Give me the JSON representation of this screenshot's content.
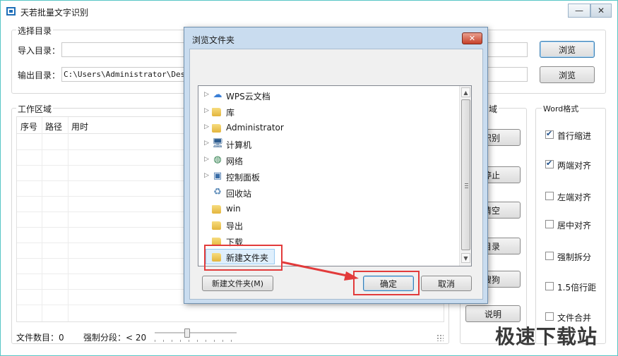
{
  "app": {
    "title": "天若批量文字识别",
    "minimize_glyph": "—",
    "close_glyph": "✕"
  },
  "dir_group": {
    "legend": "选择目录",
    "import_label": "导入目录：",
    "import_value": "",
    "output_label": "输出目录：",
    "output_value": "C:\\Users\\Administrator\\Desktop",
    "browse_label": "浏览"
  },
  "work_area": {
    "legend": "工作区域",
    "columns": [
      "序号",
      "路径",
      "用时"
    ]
  },
  "ops": {
    "legend_partial": "域",
    "buttons": [
      "识别",
      "停止",
      "清空",
      "目录",
      "搜狗",
      "说明"
    ],
    "partials": [
      "识别",
      "停止",
      "清空",
      "目录",
      "搜狗"
    ]
  },
  "word_format": {
    "legend": "Word格式",
    "options": [
      {
        "label": "首行缩进",
        "checked": true
      },
      {
        "label": "两端对齐",
        "checked": true
      },
      {
        "label": "左端对齐",
        "checked": false
      },
      {
        "label": "居中对齐",
        "checked": false
      },
      {
        "label": "强制拆分",
        "checked": false
      },
      {
        "label": "1.5倍行距",
        "checked": false
      },
      {
        "label": "文件合并",
        "checked": false
      }
    ]
  },
  "status": {
    "file_count": "文件数目：0",
    "split_label": "强制分段：< 20",
    "split_value": 20
  },
  "dialog": {
    "title": "浏览文件夹",
    "close_glyph": "✕",
    "tree": [
      {
        "label": "WPS云文档",
        "icon": "cloud-icon",
        "expandable": true
      },
      {
        "label": "库",
        "icon": "library-icon",
        "expandable": true
      },
      {
        "label": "Administrator",
        "icon": "user-folder-icon",
        "expandable": true
      },
      {
        "label": "计算机",
        "icon": "computer-icon",
        "expandable": true
      },
      {
        "label": "网络",
        "icon": "network-icon",
        "expandable": true
      },
      {
        "label": "控制面板",
        "icon": "control-panel-icon",
        "expandable": true
      },
      {
        "label": "回收站",
        "icon": "recycle-bin-icon",
        "expandable": false
      },
      {
        "label": "win",
        "icon": "folder-icon",
        "expandable": false
      },
      {
        "label": "导出",
        "icon": "folder-icon",
        "expandable": false
      },
      {
        "label": "下载",
        "icon": "folder-icon",
        "expandable": false
      },
      {
        "label": "新建文件夹",
        "icon": "folder-icon",
        "expandable": false,
        "selected": true
      }
    ],
    "new_folder_label": "新建文件夹(M)",
    "ok_label": "确定",
    "cancel_label": "取消"
  },
  "watermark": "极速下载站",
  "colors": {
    "highlight": "#e23b3b",
    "dialog_frame": "#c9dcef",
    "selection": "#dfeffc"
  }
}
